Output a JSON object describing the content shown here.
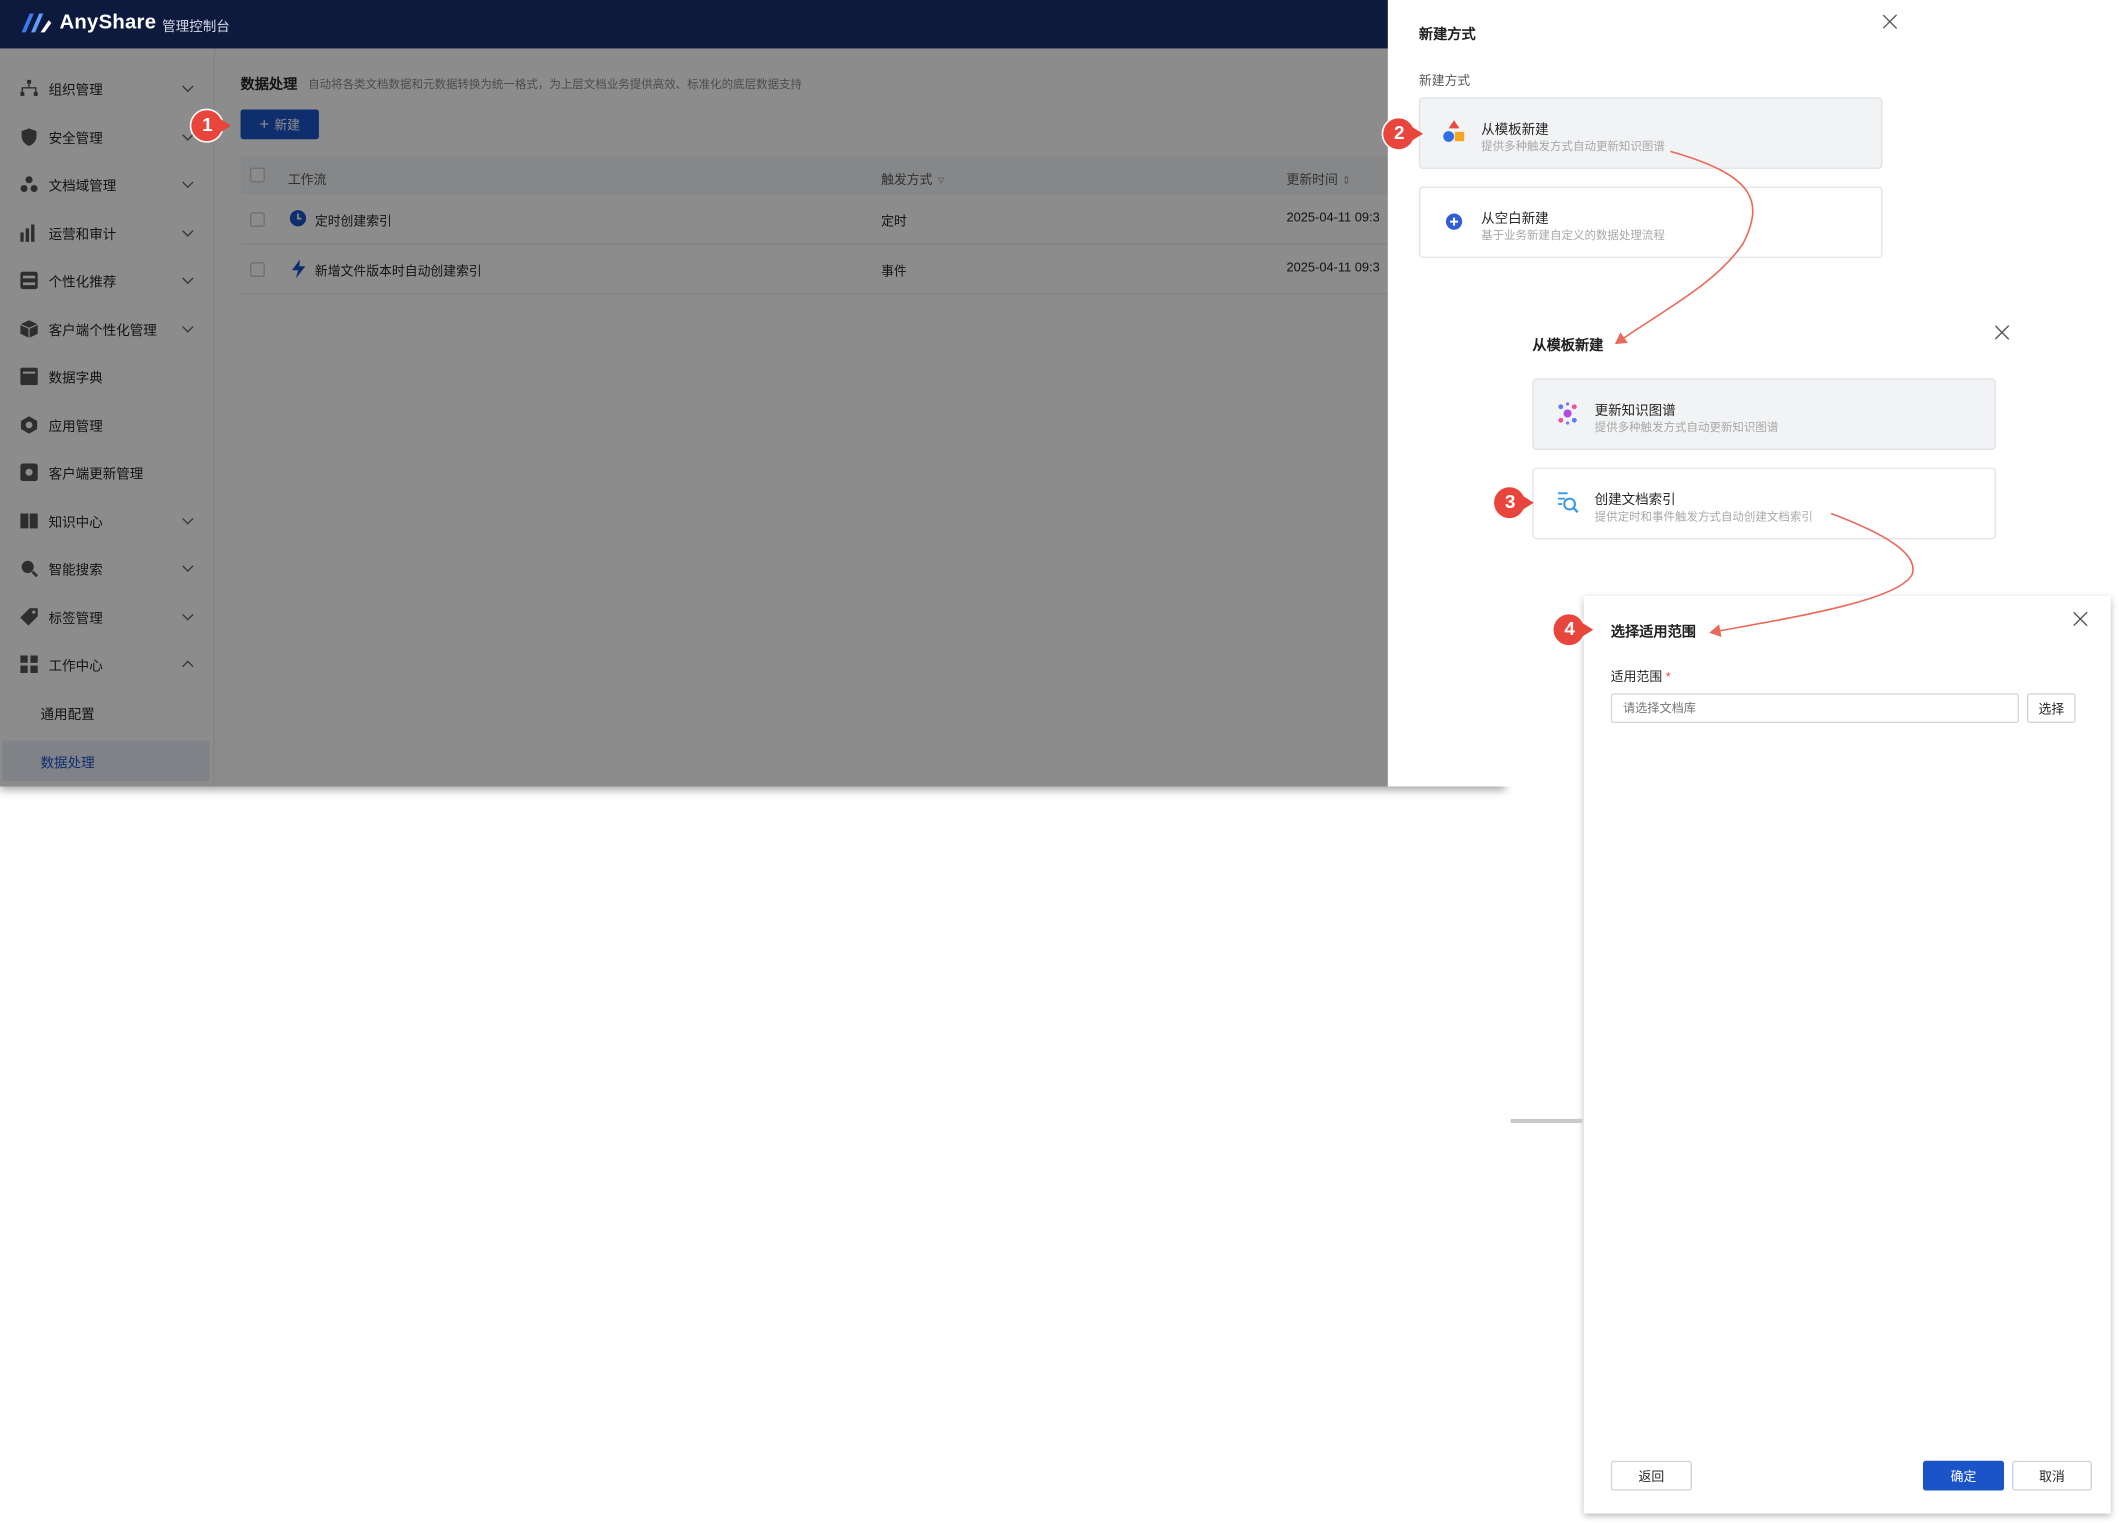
{
  "app": {
    "brand": "AnyShare",
    "console_title": "管理控制台"
  },
  "sidebar": {
    "items": [
      {
        "label": "组织管理",
        "icon": "org-icon",
        "expand": "down"
      },
      {
        "label": "安全管理",
        "icon": "shield-icon",
        "expand": "down"
      },
      {
        "label": "文档域管理",
        "icon": "domain-icon",
        "expand": "down"
      },
      {
        "label": "运营和审计",
        "icon": "bar-chart-icon",
        "expand": "down"
      },
      {
        "label": "个性化推荐",
        "icon": "recommend-icon",
        "expand": "down"
      },
      {
        "label": "客户端个性化管理",
        "icon": "cube-icon",
        "expand": "down"
      },
      {
        "label": "数据字典",
        "icon": "dictionary-icon",
        "expand": ""
      },
      {
        "label": "应用管理",
        "icon": "app-icon",
        "expand": ""
      },
      {
        "label": "客户端更新管理",
        "icon": "update-icon",
        "expand": ""
      },
      {
        "label": "知识中心",
        "icon": "book-icon",
        "expand": "down"
      },
      {
        "label": "智能搜索",
        "icon": "search-icon",
        "expand": "down"
      },
      {
        "label": "标签管理",
        "icon": "tag-icon",
        "expand": "down"
      },
      {
        "label": "工作中心",
        "icon": "grid-icon",
        "expand": "up"
      }
    ],
    "sub_items": [
      {
        "label": "通用配置",
        "active": false
      },
      {
        "label": "数据处理",
        "active": true
      }
    ]
  },
  "main": {
    "title": "数据处理",
    "description": "自动将各类文档数据和元数据转换为统一格式，为上层文档业务提供高效、标准化的底层数据支持",
    "new_button": "新建",
    "table": {
      "columns": {
        "workflow": "工作流",
        "trigger": "触发方式",
        "updated": "更新时间"
      },
      "rows": [
        {
          "name": "定时创建索引",
          "trigger": "定时",
          "updated": "2025-04-11 09:3"
        },
        {
          "name": "新增文件版本时自动创建索引",
          "trigger": "事件",
          "updated": "2025-04-11 09:3"
        }
      ]
    }
  },
  "panel1": {
    "title": "新建方式",
    "label": "新建方式",
    "options": [
      {
        "title": "从模板新建",
        "desc": "提供多种触发方式自动更新知识图谱"
      },
      {
        "title": "从空白新建",
        "desc": "基于业务新建自定义的数据处理流程"
      }
    ]
  },
  "panel2": {
    "title": "从模板新建",
    "options": [
      {
        "title": "更新知识图谱",
        "desc": "提供多种触发方式自动更新知识图谱"
      },
      {
        "title": "创建文档索引",
        "desc": "提供定时和事件触发方式自动创建文档索引"
      }
    ]
  },
  "panel3": {
    "title": "选择适用范围",
    "field_label": "适用范围",
    "required_mark": "*",
    "placeholder": "请选择文档库",
    "select_button": "选择",
    "back_button": "返回",
    "confirm_button": "确定",
    "cancel_button": "取消"
  },
  "callouts": [
    "1",
    "2",
    "3",
    "4"
  ],
  "colors": {
    "accent": "#1a54c8",
    "topbar": "#0d1a3d",
    "callout": "#e8453c",
    "arrow": "#e86a5a"
  }
}
